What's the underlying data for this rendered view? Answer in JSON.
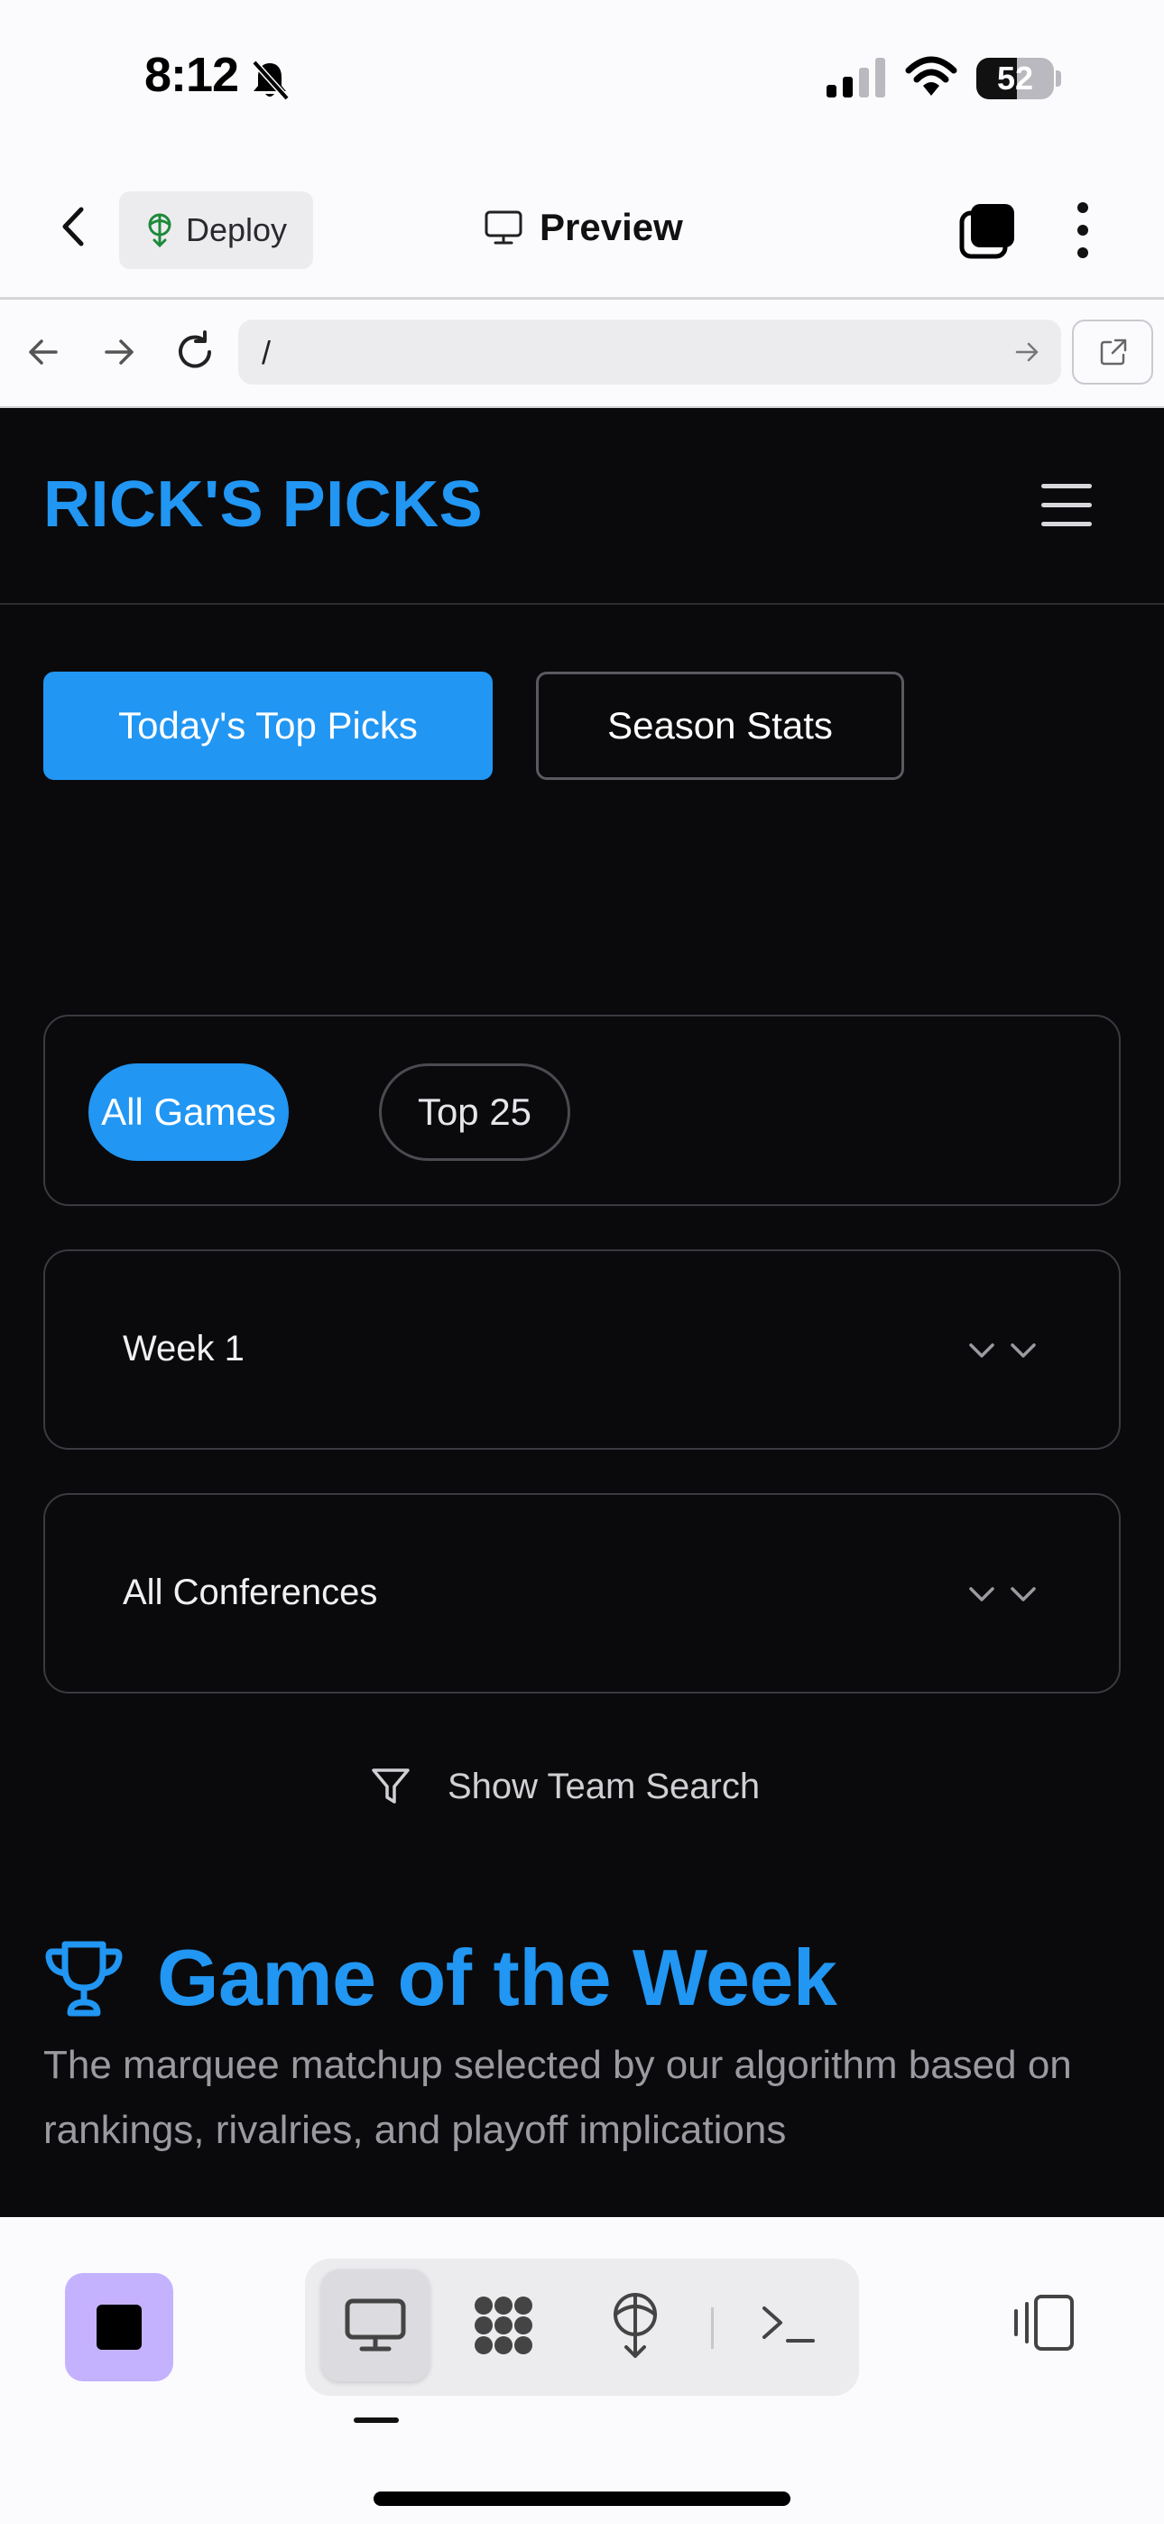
{
  "status_bar": {
    "time": "8:12",
    "battery": "52",
    "battery_level": 0.52
  },
  "app_header": {
    "deploy_label": "Deploy",
    "preview_label": "Preview"
  },
  "browser": {
    "url": "/"
  },
  "site": {
    "brand": "RICK'S PICKS",
    "primary_tab": "Today's Top Picks",
    "secondary_tab": "Season Stats",
    "filters": {
      "all_games": "All Games",
      "top25": "Top 25"
    },
    "week_select": "Week 1",
    "conference_select": "All Conferences",
    "team_search": "Show Team Search",
    "gotw_title": "Game of the Week",
    "gotw_desc": "The marquee matchup selected by our algorithm based on rankings, rivalries, and playoff implications"
  },
  "colors": {
    "accent": "#2196f3",
    "background": "#0a0a0c",
    "stop_button": "#c4b2ff"
  },
  "icons": [
    "bell-slash-icon",
    "signal-icon",
    "wifi-icon",
    "battery-icon",
    "back-chevron-icon",
    "deploy-icon",
    "monitor-icon",
    "tabs-icon",
    "more-icon",
    "arrow-left-icon",
    "arrow-right-icon",
    "reload-icon",
    "external-link-icon",
    "hamburger-icon",
    "chevron-down-icon",
    "filter-icon",
    "trophy-icon",
    "stop-icon",
    "desktop-icon",
    "apps-icon",
    "deploy-tab-icon",
    "terminal-icon",
    "device-icon"
  ]
}
